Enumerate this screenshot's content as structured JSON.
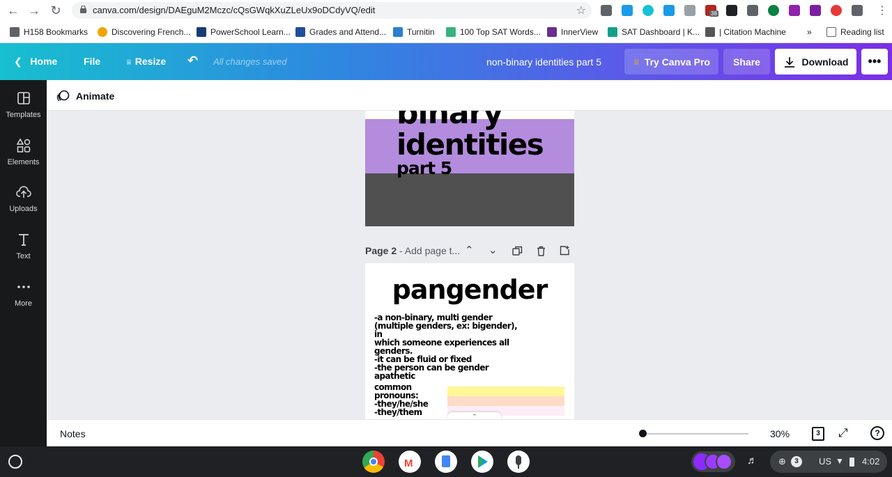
{
  "browser": {
    "url": "canva.com/design/DAEguM2Mczc/cQsGWqkXuZLeUx9oDCdyVQ/edit",
    "extension_badge": "38",
    "bookmarks": [
      {
        "label": "H158 Bookmarks",
        "color": "#5f6368"
      },
      {
        "label": "Discovering French...",
        "color": "#f4a400"
      },
      {
        "label": "PowerSchool Learn...",
        "color": "#1a3c73"
      },
      {
        "label": "Grades and Attend...",
        "color": "#1f4e9a"
      },
      {
        "label": "Turnitin",
        "color": "#2a7fd4"
      },
      {
        "label": "100 Top SAT Words...",
        "color": "#36b37e"
      },
      {
        "label": "InnerView",
        "color": "#6b2d8f"
      },
      {
        "label": "SAT Dashboard | K...",
        "color": "#14a085"
      },
      {
        "label": "| Citation Machine",
        "color": "#555555"
      }
    ],
    "overflow_label": "»",
    "reading_list": "Reading list"
  },
  "header": {
    "home": "Home",
    "file": "File",
    "resize": "Resize",
    "saved_status": "All changes saved",
    "design_title": "non-binary identities part 5",
    "try_pro": "Try Canva Pro",
    "share": "Share",
    "download": "Download"
  },
  "sidebar": {
    "items": [
      {
        "label": "Templates",
        "icon": "templates-icon"
      },
      {
        "label": "Elements",
        "icon": "elements-icon"
      },
      {
        "label": "Uploads",
        "icon": "uploads-icon"
      },
      {
        "label": "Text",
        "icon": "text-icon"
      },
      {
        "label": "More",
        "icon": "more-icon"
      }
    ]
  },
  "toolbar": {
    "animate": "Animate"
  },
  "page1": {
    "line1": "binary",
    "line2": "identities",
    "line3": "part 5",
    "purple": "#b48cde",
    "gray": "#505050"
  },
  "page2": {
    "label_number": "Page 2",
    "label_title": "- Add page t...",
    "title": "pangender",
    "body_lines": [
      "-a non-binary, multi gender",
      "(multiple genders, ex: bigender), in",
      "which someone experiences all",
      "genders.",
      "-it can be fluid or fixed",
      "-the person can be gender",
      "apathetic"
    ],
    "pronoun_lines": [
      "common",
      "pronouns:",
      "-they/he/she",
      "-they/them"
    ],
    "flag_colors": [
      "#fff798",
      "#fedcc7",
      "#fdedf7"
    ]
  },
  "footer": {
    "notes": "Notes",
    "zoom": "30%",
    "page_count": "3",
    "help": "?"
  },
  "shelf": {
    "locale": "US",
    "notifications": "3",
    "time": "4:02"
  }
}
